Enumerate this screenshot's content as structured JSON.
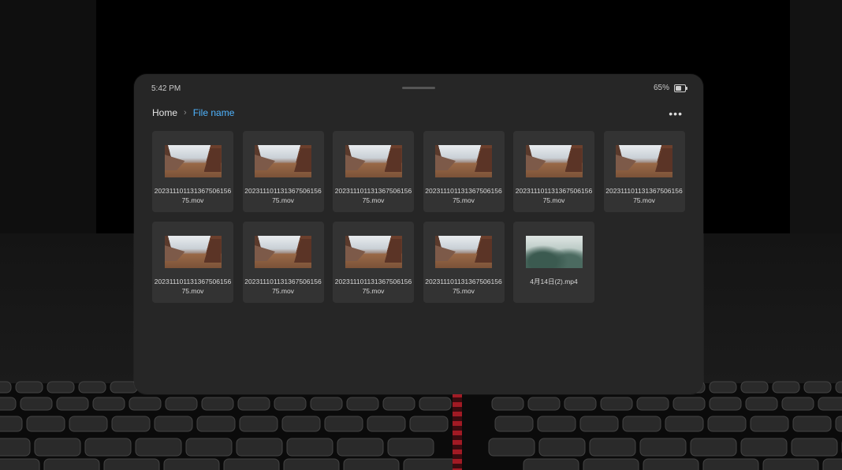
{
  "status": {
    "time": "5:42 PM",
    "battery": "65%",
    "battery_level": 0.65
  },
  "breadcrumb": {
    "home": "Home",
    "separator": "›",
    "current": "File name"
  },
  "menu": {
    "more": "•••"
  },
  "accent_color": "#4fb4ff",
  "files": [
    {
      "line1": "20231110113136750615675.mov",
      "thumb": "canyon"
    },
    {
      "line1": "20231110113136750615675.mov",
      "thumb": "canyon"
    },
    {
      "line1": "20231110113136750615675.mov",
      "thumb": "canyon"
    },
    {
      "line1": "20231110113136750615675.mov",
      "thumb": "canyon"
    },
    {
      "line1": "20231110113136750615675.mov",
      "thumb": "canyon"
    },
    {
      "line1": "20231110113136750615675.mov",
      "thumb": "canyon"
    },
    {
      "line1": "20231110113136750615675.mov",
      "thumb": "canyon"
    },
    {
      "line1": "20231110113136750615675.mov",
      "thumb": "canyon"
    },
    {
      "line1": "20231110113136750615675.mov",
      "thumb": "canyon"
    },
    {
      "line1": "20231110113136750615675.mov",
      "thumb": "canyon"
    },
    {
      "line1": "4月14日(2).mp4",
      "thumb": "forest"
    }
  ]
}
